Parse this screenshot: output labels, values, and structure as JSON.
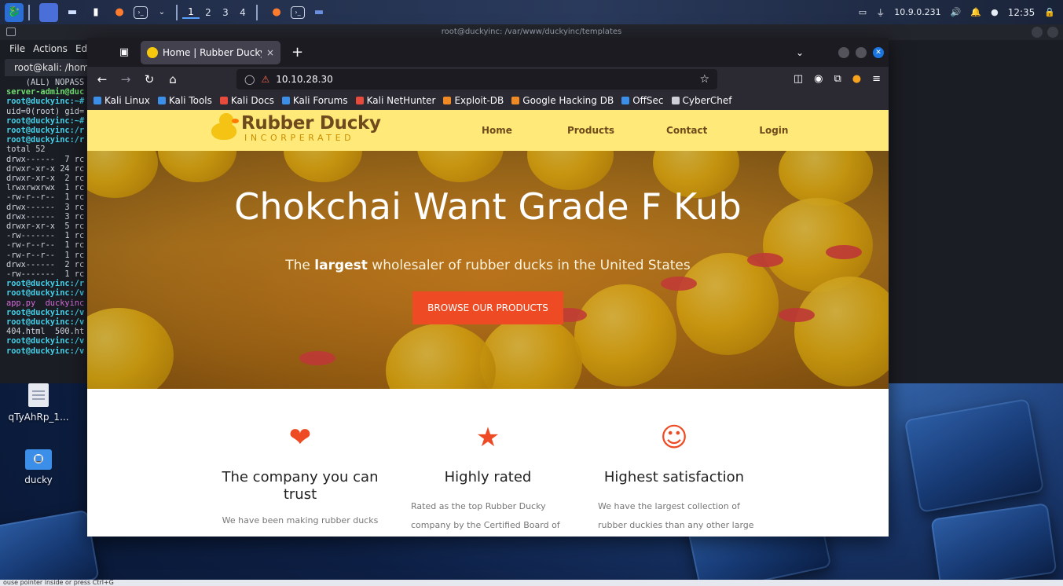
{
  "panel": {
    "workspaces": [
      "1",
      "2",
      "3",
      "4"
    ],
    "ip": "10.9.0.231",
    "clock": "12:35"
  },
  "terminal": {
    "title": "root@duckyinc: /var/www/duckyinc/templates",
    "menu": [
      "File",
      "Actions",
      "Ed"
    ],
    "tab": "root@kali: /home",
    "lines": [
      {
        "text": "    (ALL) NOPASS",
        "kind": "normal"
      },
      {
        "text": "server-admin@duc",
        "kind": "green"
      },
      {
        "text": "root@duckyinc:~#",
        "kind": "prompt"
      },
      {
        "text": "uid=0(root) gid=",
        "kind": "normal"
      },
      {
        "text": "root@duckyinc:~#",
        "kind": "prompt"
      },
      {
        "text": "root@duckyinc:/r",
        "kind": "prompt"
      },
      {
        "text": "root@duckyinc:/r",
        "kind": "prompt"
      },
      {
        "text": "total 52",
        "kind": "normal"
      },
      {
        "text": "drwx------  7 rc",
        "kind": "normal"
      },
      {
        "text": "drwxr-xr-x 24 rc",
        "kind": "normal"
      },
      {
        "text": "drwxr-xr-x  2 rc",
        "kind": "normal"
      },
      {
        "text": "lrwxrwxrwx  1 rc",
        "kind": "normal"
      },
      {
        "text": "-rw-r--r--  1 rc",
        "kind": "normal"
      },
      {
        "text": "drwx------  3 rc",
        "kind": "normal"
      },
      {
        "text": "drwx------  3 rc",
        "kind": "normal"
      },
      {
        "text": "drwxr-xr-x  5 rc",
        "kind": "normal"
      },
      {
        "text": "-rw-------  1 rc",
        "kind": "normal"
      },
      {
        "text": "-rw-r--r--  1 rc",
        "kind": "normal"
      },
      {
        "text": "-rw-r--r--  1 rc",
        "kind": "normal"
      },
      {
        "text": "drwx------  2 rc",
        "kind": "normal"
      },
      {
        "text": "-rw-------  1 rc",
        "kind": "normal"
      },
      {
        "text": "root@duckyinc:/r",
        "kind": "prompt"
      },
      {
        "text": "root@duckyinc:/v",
        "kind": "prompt"
      },
      {
        "text": "app.py  duckyinc",
        "kind": "purple"
      },
      {
        "text": "root@duckyinc:/v",
        "kind": "prompt"
      },
      {
        "text": "root@duckyinc:/v",
        "kind": "prompt"
      },
      {
        "text": "404.html  500.ht",
        "kind": "normal"
      },
      {
        "text": "root@duckyinc:/v",
        "kind": "prompt"
      },
      {
        "text": "root@duckyinc:/v",
        "kind": "prompt"
      }
    ]
  },
  "desktop": {
    "icons": [
      {
        "label": "qTyAhRp_1..."
      },
      {
        "label": "ducky"
      }
    ]
  },
  "bottom_hint": "ouse pointer inside or press Ctrl+G",
  "browser": {
    "tab_title": "Home | Rubber Ducky Inc.",
    "tab_close": "×",
    "new_tab": "+",
    "url": "10.10.28.30",
    "bookmarks": [
      {
        "label": "Kali Linux",
        "color": "#3b8fe8"
      },
      {
        "label": "Kali Tools",
        "color": "#3b8fe8"
      },
      {
        "label": "Kali Docs",
        "color": "#e84a3b"
      },
      {
        "label": "Kali Forums",
        "color": "#3b8fe8"
      },
      {
        "label": "Kali NetHunter",
        "color": "#e84a3b"
      },
      {
        "label": "Exploit-DB",
        "color": "#f08a24"
      },
      {
        "label": "Google Hacking DB",
        "color": "#f08a24"
      },
      {
        "label": "OffSec",
        "color": "#3b8fe8"
      },
      {
        "label": "CyberChef",
        "color": "#cfcfd8"
      }
    ]
  },
  "site": {
    "logo_main": "Rubber Ducky",
    "logo_sub": "INCORPERATED",
    "nav": [
      "Home",
      "Products",
      "Contact",
      "Login"
    ],
    "hero_title": "Chokchai Want Grade F Kub",
    "hero_sub_pre": "The ",
    "hero_sub_bold": "largest",
    "hero_sub_post": " wholesaler of rubber ducks in the United States",
    "hero_button": "BROWSE OUR PRODUCTS",
    "features": [
      {
        "icon": "heart-icon",
        "title": "The company you can trust",
        "text": "We have been making rubber ducks"
      },
      {
        "icon": "star-icon",
        "title": "Highly rated",
        "text": "Rated as the top Rubber Ducky company by the Certified Board of"
      },
      {
        "icon": "smile-icon",
        "title": "Highest satisfaction",
        "text": "We have the largest collection of rubber duckies than any other large"
      }
    ],
    "colors": {
      "nav_bg": "#ffea79",
      "accent": "#ee4b24",
      "brown": "#6e4a1c"
    }
  }
}
